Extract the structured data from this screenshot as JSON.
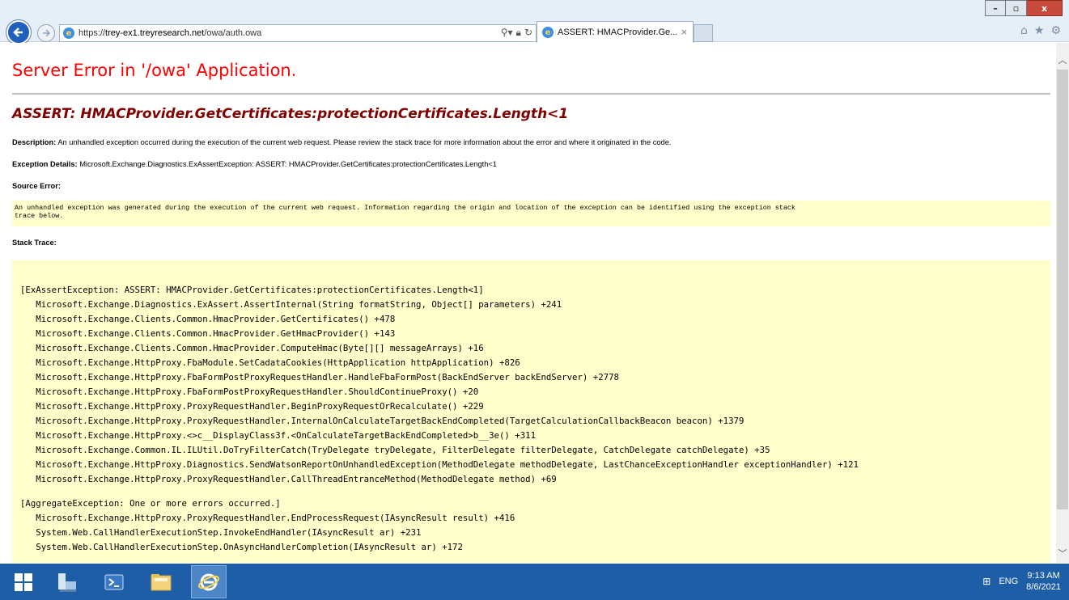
{
  "browser": {
    "url_prefix": "https://",
    "url_host": "trey-ex1.treyresearch.net",
    "url_path": "/owa/auth.owa",
    "tab_title": "ASSERT: HMACProvider.Ge...",
    "tab_close": "×",
    "window_controls": {
      "minimize": "–",
      "restore": "▫",
      "close": "x"
    },
    "icons": [
      "back-arrow-icon",
      "forward-arrow-icon",
      "ie-icon",
      "search-icon",
      "lock-icon",
      "refresh-icon",
      "home-icon",
      "favorites-star-icon",
      "settings-gear-icon"
    ]
  },
  "page": {
    "title": "Server Error in '/owa' Application.",
    "assert_heading": "ASSERT: HMACProvider.GetCertificates:protectionCertificates.Length<1",
    "description_label": "Description:",
    "description_text": " An unhandled exception occurred during the execution of the current web request. Please review the stack trace for more information about the error and where it originated in the code.",
    "exception_label": "Exception Details:",
    "exception_text": " Microsoft.Exchange.Diagnostics.ExAssertException: ASSERT: HMACProvider.GetCertificates:protectionCertificates.Length<1",
    "source_error_label": "Source Error:",
    "source_error_line1": "An unhandled exception was generated during the execution of the current web request. Information regarding the origin and location of the exception can be identified using the exception stack",
    "source_error_line2": "trace below.",
    "stack_trace_label": "Stack Trace:",
    "stack_block1": [
      "[ExAssertException: ASSERT: HMACProvider.GetCertificates:protectionCertificates.Length<1]",
      "   Microsoft.Exchange.Diagnostics.ExAssert.AssertInternal(String formatString, Object[] parameters) +241",
      "   Microsoft.Exchange.Clients.Common.HmacProvider.GetCertificates() +478",
      "   Microsoft.Exchange.Clients.Common.HmacProvider.GetHmacProvider() +143",
      "   Microsoft.Exchange.Clients.Common.HmacProvider.ComputeHmac(Byte[][] messageArrays) +16",
      "   Microsoft.Exchange.HttpProxy.FbaModule.SetCadataCookies(HttpApplication httpApplication) +826",
      "   Microsoft.Exchange.HttpProxy.FbaFormPostProxyRequestHandler.HandleFbaFormPost(BackEndServer backEndServer) +2778",
      "   Microsoft.Exchange.HttpProxy.FbaFormPostProxyRequestHandler.ShouldContinueProxy() +20",
      "   Microsoft.Exchange.HttpProxy.ProxyRequestHandler.BeginProxyRequestOrRecalculate() +229",
      "   Microsoft.Exchange.HttpProxy.ProxyRequestHandler.InternalOnCalculateTargetBackEndCompleted(TargetCalculationCallbackBeacon beacon) +1379",
      "   Microsoft.Exchange.HttpProxy.<>c__DisplayClass3f.<OnCalculateTargetBackEndCompleted>b__3e() +311",
      "   Microsoft.Exchange.Common.IL.ILUtil.DoTryFilterCatch(TryDelegate tryDelegate, FilterDelegate filterDelegate, CatchDelegate catchDelegate) +35",
      "   Microsoft.Exchange.HttpProxy.Diagnostics.SendWatsonReportOnUnhandledException(MethodDelegate methodDelegate, LastChanceExceptionHandler exceptionHandler) +121",
      "   Microsoft.Exchange.HttpProxy.ProxyRequestHandler.CallThreadEntranceMethod(MethodDelegate method) +69"
    ],
    "stack_block2": [
      "[AggregateException: One or more errors occurred.]",
      "   Microsoft.Exchange.HttpProxy.ProxyRequestHandler.EndProcessRequest(IAsyncResult result) +416",
      "   System.Web.CallHandlerExecutionStep.InvokeEndHandler(IAsyncResult ar) +231",
      "   System.Web.CallHandlerExecutionStep.OnAsyncHandlerCompletion(IAsyncResult ar) +172"
    ]
  },
  "taskbar": {
    "apps": [
      "start-icon",
      "server-manager-icon",
      "powershell-icon",
      "file-explorer-icon",
      "internet-explorer-icon"
    ],
    "language": "ENG",
    "time": "9:13 AM",
    "date": "8/6/2021"
  },
  "colors": {
    "title_red": "#ff0000",
    "heading_maroon": "#800000",
    "code_bg": "#ffffcc",
    "taskbar": "#1e5ea6"
  }
}
